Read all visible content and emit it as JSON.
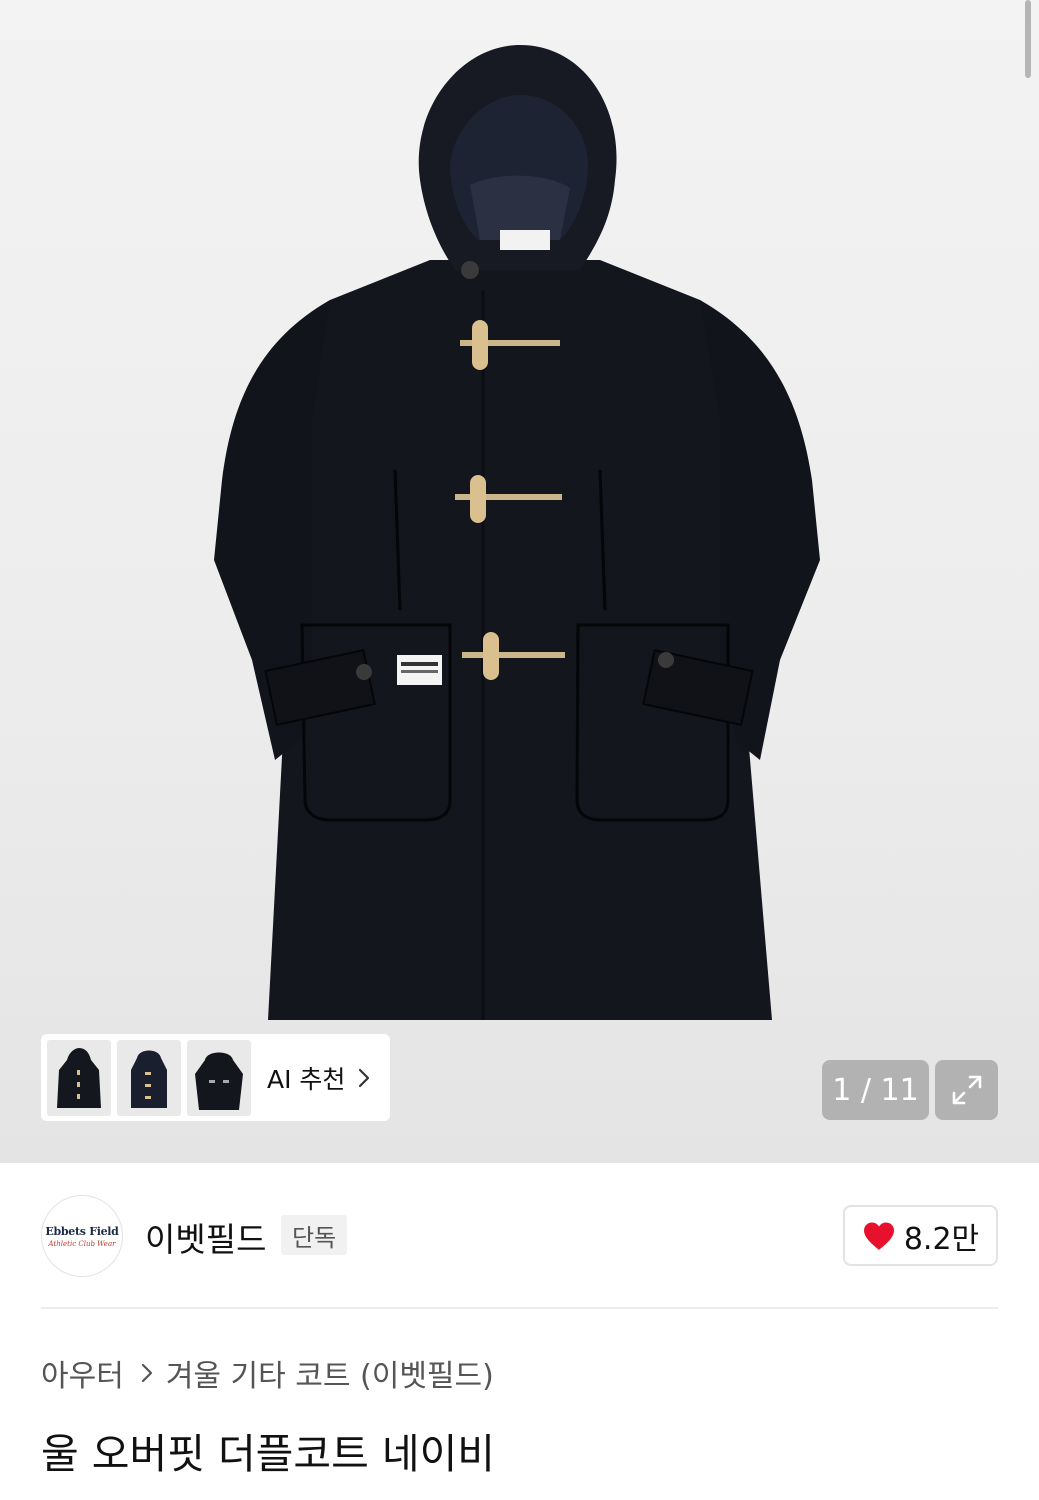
{
  "gallery": {
    "ai_label": "AI 추천",
    "counter": "1 / 11",
    "thumbnails": [
      "coat-front-thumb",
      "coat-hood-thumb",
      "coat-open-thumb"
    ]
  },
  "brand": {
    "logo_line1": "Ebbets Field",
    "logo_line2": "Athletic Club Wear",
    "name": "이벳필드",
    "badge": "단독",
    "likes": "8.2만"
  },
  "breadcrumb": {
    "category": "아우터",
    "subcategory": "겨울 기타 코트 (이벳필드)"
  },
  "product": {
    "title": "울 오버핏 더플코트 네이비"
  },
  "colors": {
    "coat": "#15171f",
    "toggle": "#d9c08e",
    "heart": "#e8112d"
  }
}
